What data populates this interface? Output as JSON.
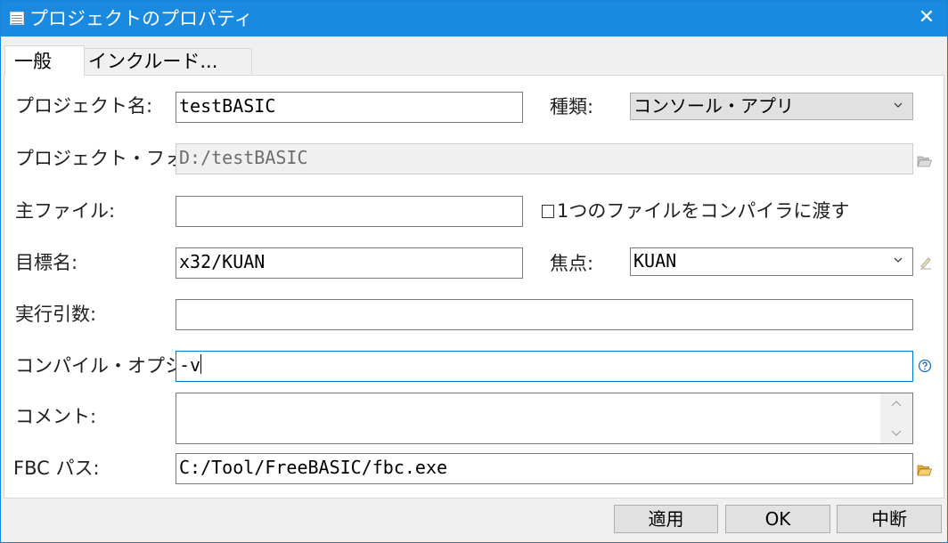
{
  "window": {
    "title": "プロジェクトのプロパティ",
    "close": "✕"
  },
  "tabs": [
    {
      "label": "一般"
    },
    {
      "label": "インクルード..."
    }
  ],
  "fields": {
    "project_name": {
      "label": "プロジェクト名:",
      "value": "testBASIC"
    },
    "type": {
      "label": "種類:",
      "value": "コンソール・アプリ"
    },
    "project_folder": {
      "label": "プロジェクト・フォルダ:",
      "value": "D:/testBASIC"
    },
    "main_file": {
      "label": "主ファイル:",
      "value": ""
    },
    "pass_one_file": {
      "label": "1つのファイルをコンパイラに渡す",
      "checked": false
    },
    "target_name": {
      "label": "目標名:",
      "value": "x32/KUAN"
    },
    "focus": {
      "label": "焦点:",
      "value": "KUAN"
    },
    "run_args": {
      "label": "実行引数:",
      "value": ""
    },
    "compile_options": {
      "label": "コンパイル・オプション:",
      "value": "-v"
    },
    "comment": {
      "label": "コメント:",
      "value": ""
    },
    "fbc_path": {
      "label": "FBC パス:",
      "value": "C:/Tool/FreeBASIC/fbc.exe"
    }
  },
  "icons": {
    "folder_open": "folder-open-icon",
    "edit": "pencil-icon",
    "help": "help-icon",
    "chevron": "chevron-down-icon",
    "scroll_up": "▲",
    "scroll_down": "▼"
  },
  "buttons": {
    "apply": "適用",
    "ok": "OK",
    "cancel": "中断"
  },
  "colors": {
    "titlebar": "#1a8ae0",
    "focus_border": "#0078d7",
    "folder_icon": "#e8b040",
    "help_icon": "#1f6fbf"
  }
}
